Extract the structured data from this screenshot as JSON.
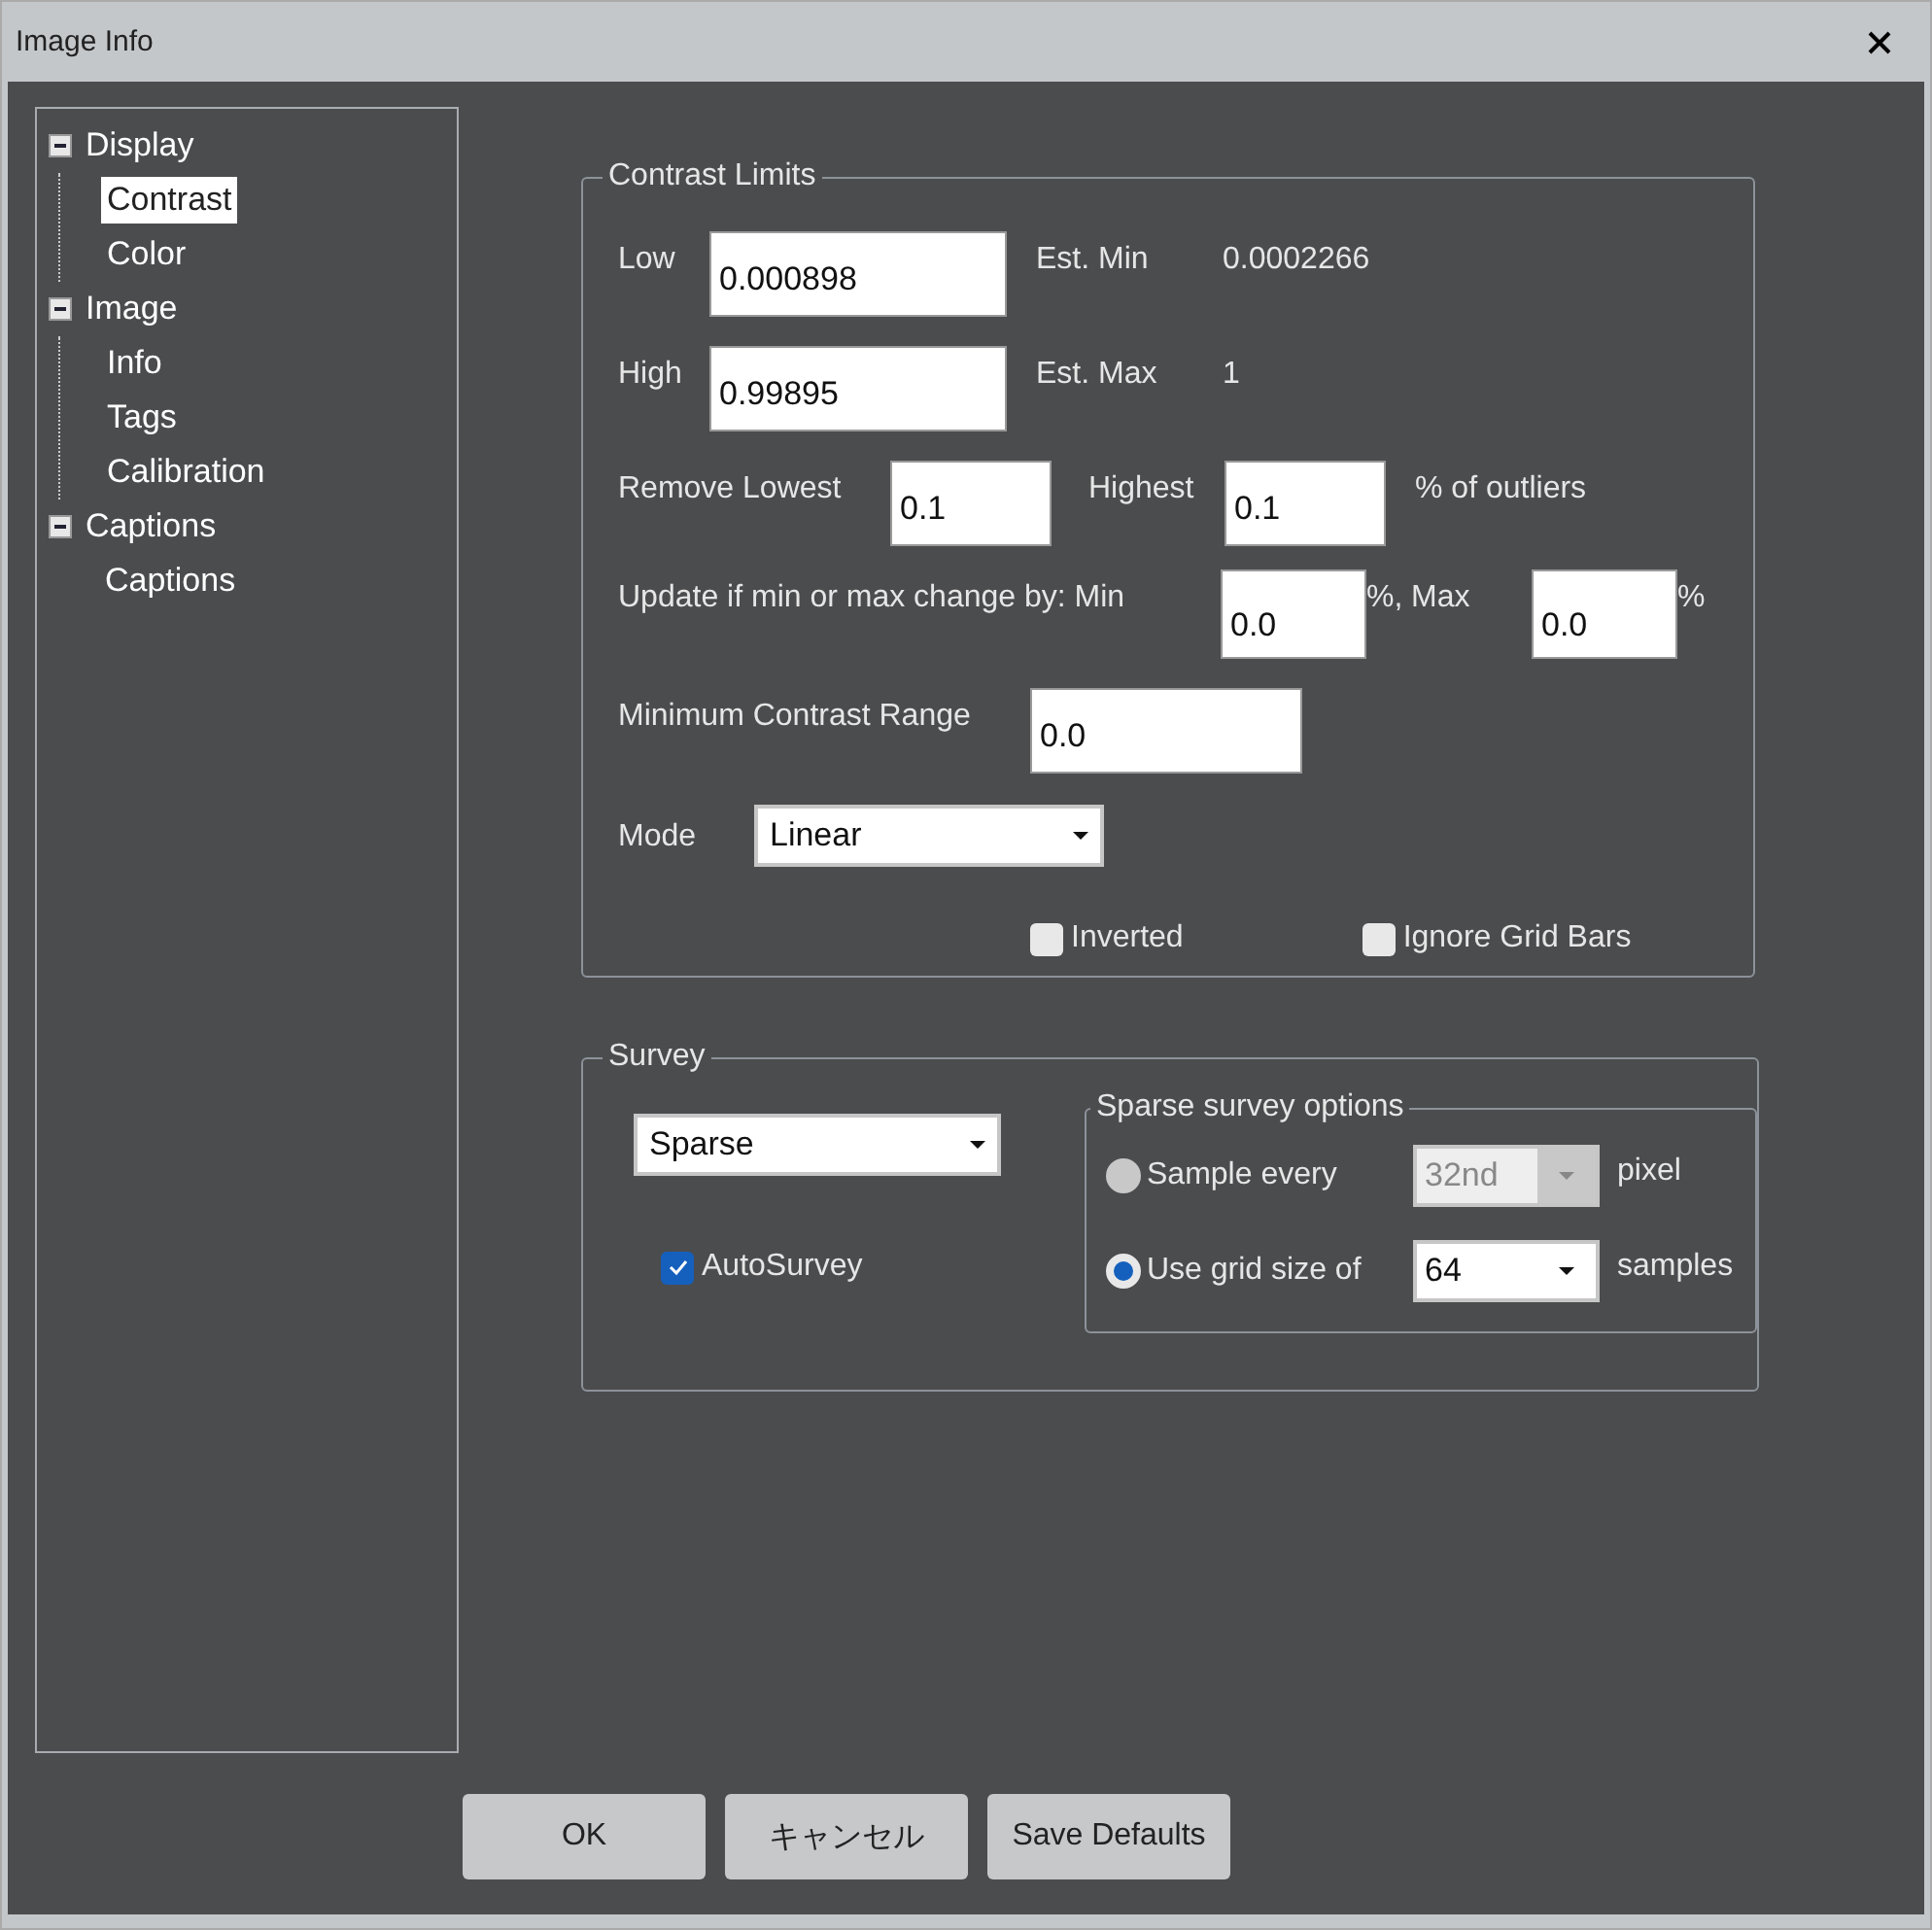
{
  "window": {
    "title": "Image Info"
  },
  "tree": [
    {
      "label": "Display",
      "expanded": true,
      "selected": false,
      "children": [
        {
          "label": "Contrast",
          "selected": true
        },
        {
          "label": "Color",
          "selected": false
        }
      ]
    },
    {
      "label": "Image",
      "expanded": true,
      "selected": false,
      "children": [
        {
          "label": "Info",
          "selected": false
        },
        {
          "label": "Tags",
          "selected": false
        },
        {
          "label": "Calibration",
          "selected": false
        }
      ]
    },
    {
      "label": "Captions",
      "expanded": true,
      "selected": false,
      "children": [
        {
          "label": "Captions",
          "selected": false
        }
      ]
    }
  ],
  "contrast_limits": {
    "title": "Contrast Limits",
    "low": {
      "label": "Low",
      "value": "0.000898",
      "est_label": "Est. Min",
      "est_value": "0.0002266"
    },
    "high": {
      "label": "High",
      "value": "0.99895",
      "est_label": "Est. Max",
      "est_value": "1"
    },
    "remove": {
      "label": "Remove Lowest",
      "lowest": "0.1",
      "highest_label": "Highest",
      "highest": "0.1",
      "suffix": "% of outliers"
    },
    "update": {
      "label": "Update if min or max change by: Min",
      "min": "0.0",
      "min_suffix": "%,",
      "max_label": "Max",
      "max": "0.0",
      "max_suffix": "%"
    },
    "min_range": {
      "label": "Minimum Contrast Range",
      "value": "0.0"
    },
    "mode": {
      "label": "Mode",
      "value": "Linear"
    },
    "checkboxes": [
      {
        "label": "Inverted",
        "checked": false
      },
      {
        "label": "Ignore Grid Bars",
        "checked": false
      }
    ]
  },
  "survey": {
    "title": "Survey",
    "type": "Sparse",
    "autosurvey": {
      "label": "AutoSurvey",
      "checked": true
    },
    "options": {
      "title": "Sparse survey options",
      "rows": [
        {
          "label": "Sample every",
          "value": "32nd",
          "suffix": "pixel",
          "selected": false,
          "disabled": true
        },
        {
          "label": "Use grid size of",
          "value": "64",
          "suffix": "samples",
          "selected": true,
          "disabled": false
        }
      ]
    }
  },
  "buttons": [
    "OK",
    "キャンセル",
    "Save Defaults"
  ]
}
